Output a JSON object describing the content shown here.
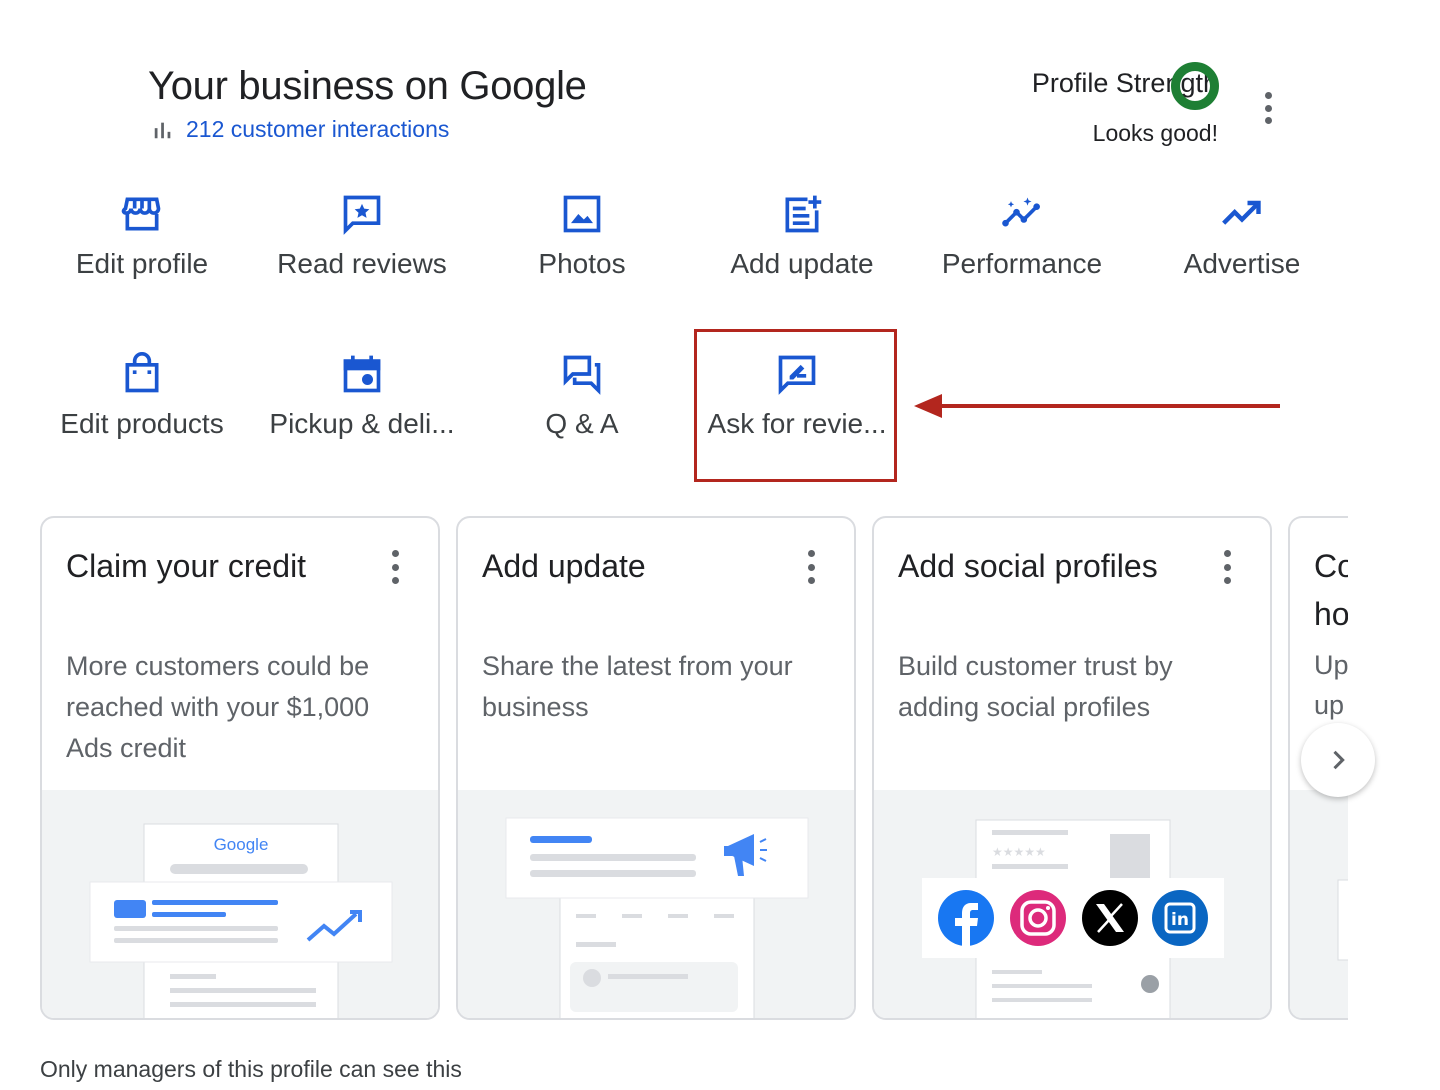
{
  "header": {
    "title": "Your business on Google",
    "interactions": "212 customer interactions",
    "profile_strength_label": "Profile Strength",
    "profile_strength_status": "Looks good!"
  },
  "actions": [
    {
      "label": "Edit profile",
      "icon": "storefront-icon"
    },
    {
      "label": "Read reviews",
      "icon": "review-star-icon"
    },
    {
      "label": "Photos",
      "icon": "photo-icon"
    },
    {
      "label": "Add update",
      "icon": "post-add-icon"
    },
    {
      "label": "Performance",
      "icon": "insights-icon"
    },
    {
      "label": "Advertise",
      "icon": "trending-up-icon"
    },
    {
      "label": "Edit products",
      "icon": "shopping-bag-icon"
    },
    {
      "label": "Pickup & deli...",
      "icon": "calendar-icon"
    },
    {
      "label": "Q & A",
      "icon": "forum-icon"
    },
    {
      "label": "Ask for revie...",
      "icon": "rate-review-icon"
    }
  ],
  "cards": [
    {
      "title": "Claim your credit",
      "description": "More customers could be reached with your $1,000 Ads credit"
    },
    {
      "title": "Add update",
      "description": "Share the latest from your business"
    },
    {
      "title": "Add social profiles",
      "description": "Build customer trust by adding social profiles"
    }
  ],
  "partial_card": {
    "title_line1": "Co",
    "title_line2": "ho",
    "desc_line1": "Up",
    "desc_line2": "up"
  },
  "illustration": {
    "google_wordmark": "Google"
  },
  "footer_note": "Only managers of this profile can see this",
  "colors": {
    "accent_blue": "#1a57d1",
    "strength_green": "#1e7f34",
    "highlight_red": "#b3261e",
    "facebook": "#1877f2",
    "linkedin": "#0a66c2"
  }
}
